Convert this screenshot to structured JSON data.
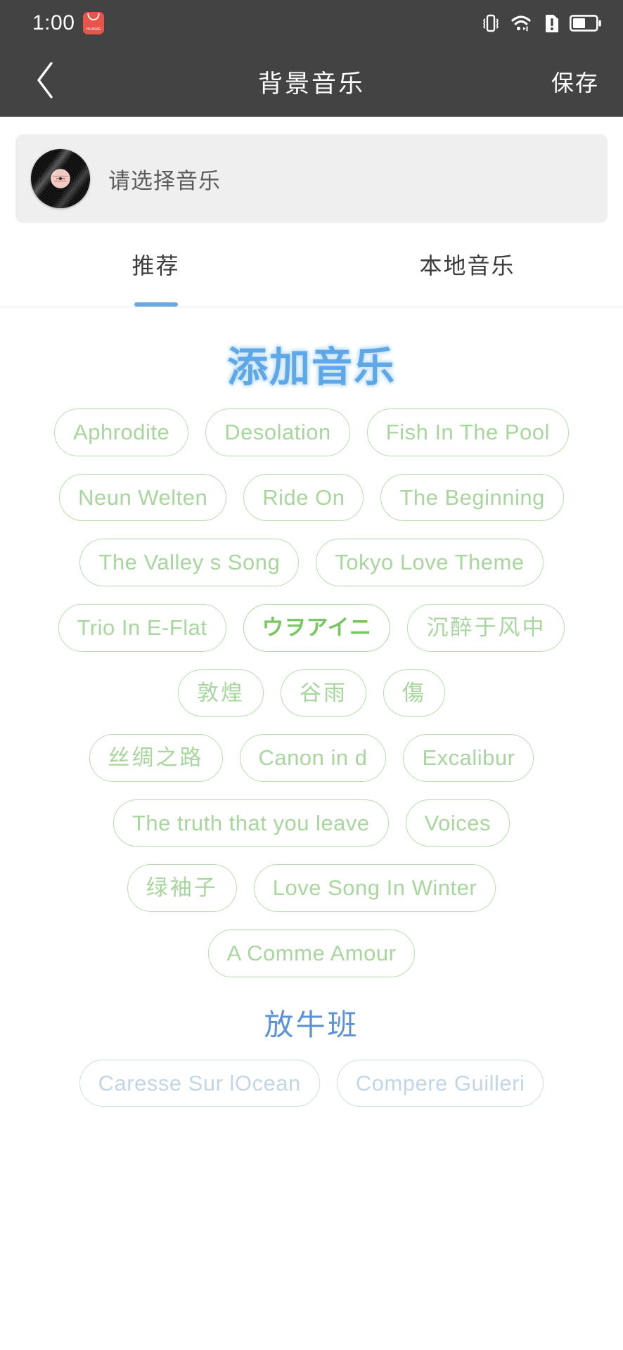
{
  "status_bar": {
    "time": "1:00",
    "brand_badge": "HUAWEI",
    "icons": [
      "vibrate-icon",
      "wifi-icon",
      "sim-alert-icon",
      "battery-icon"
    ],
    "battery_level_pct": 55
  },
  "header": {
    "back_icon": "chevron-left-icon",
    "title": "背景音乐",
    "save_label": "保存"
  },
  "music_card": {
    "thumbnail_icon": "vinyl-record-icon",
    "placeholder": "请选择音乐"
  },
  "tabs": [
    {
      "label": "推荐",
      "active": true
    },
    {
      "label": "本地音乐",
      "active": false
    }
  ],
  "sections": [
    {
      "title": "添加音乐",
      "title_style": "hero",
      "rows": [
        [
          {
            "label": "Aphrodite"
          },
          {
            "label": "Desolation"
          },
          {
            "label": "Fish In The Pool"
          }
        ],
        [
          {
            "label": "Neun Welten"
          },
          {
            "label": "Ride On"
          },
          {
            "label": "The Beginning"
          }
        ],
        [
          {
            "label": "The Valley s Song"
          },
          {
            "label": "Tokyo Love Theme"
          }
        ],
        [
          {
            "label": "Trio In E-Flat"
          },
          {
            "label": "ウヲアイニ",
            "style": "strong"
          },
          {
            "label": "沉醉于风中",
            "style": "cjk"
          }
        ],
        [
          {
            "label": "敦煌",
            "style": "cjk"
          },
          {
            "label": "谷雨",
            "style": "cjk"
          },
          {
            "label": "傷",
            "style": "cjk"
          }
        ],
        [
          {
            "label": "丝绸之路",
            "style": "cjk"
          },
          {
            "label": "Canon in d"
          },
          {
            "label": "Excalibur"
          }
        ],
        [
          {
            "label": "The truth that you leave"
          },
          {
            "label": "Voices"
          }
        ],
        [
          {
            "label": "绿袖子",
            "style": "cjk"
          },
          {
            "label": "Love Song In Winter"
          }
        ],
        [
          {
            "label": "A Comme Amour"
          }
        ]
      ]
    },
    {
      "title": "放牛班",
      "title_style": "plain",
      "rows": [
        [
          {
            "label": "Caresse Sur lOcean",
            "style": "faded"
          },
          {
            "label": "Compere Guilleri",
            "style": "faded"
          }
        ]
      ]
    }
  ],
  "colors": {
    "status_bar_bg": "#434343",
    "chip_border": "#b7dfae",
    "chip_text": "#a7d79c",
    "tab_accent": "#6aa9e0",
    "hero_title": "#5fa8e8",
    "section_title": "#5b93d6",
    "card_bg": "#efefef"
  }
}
